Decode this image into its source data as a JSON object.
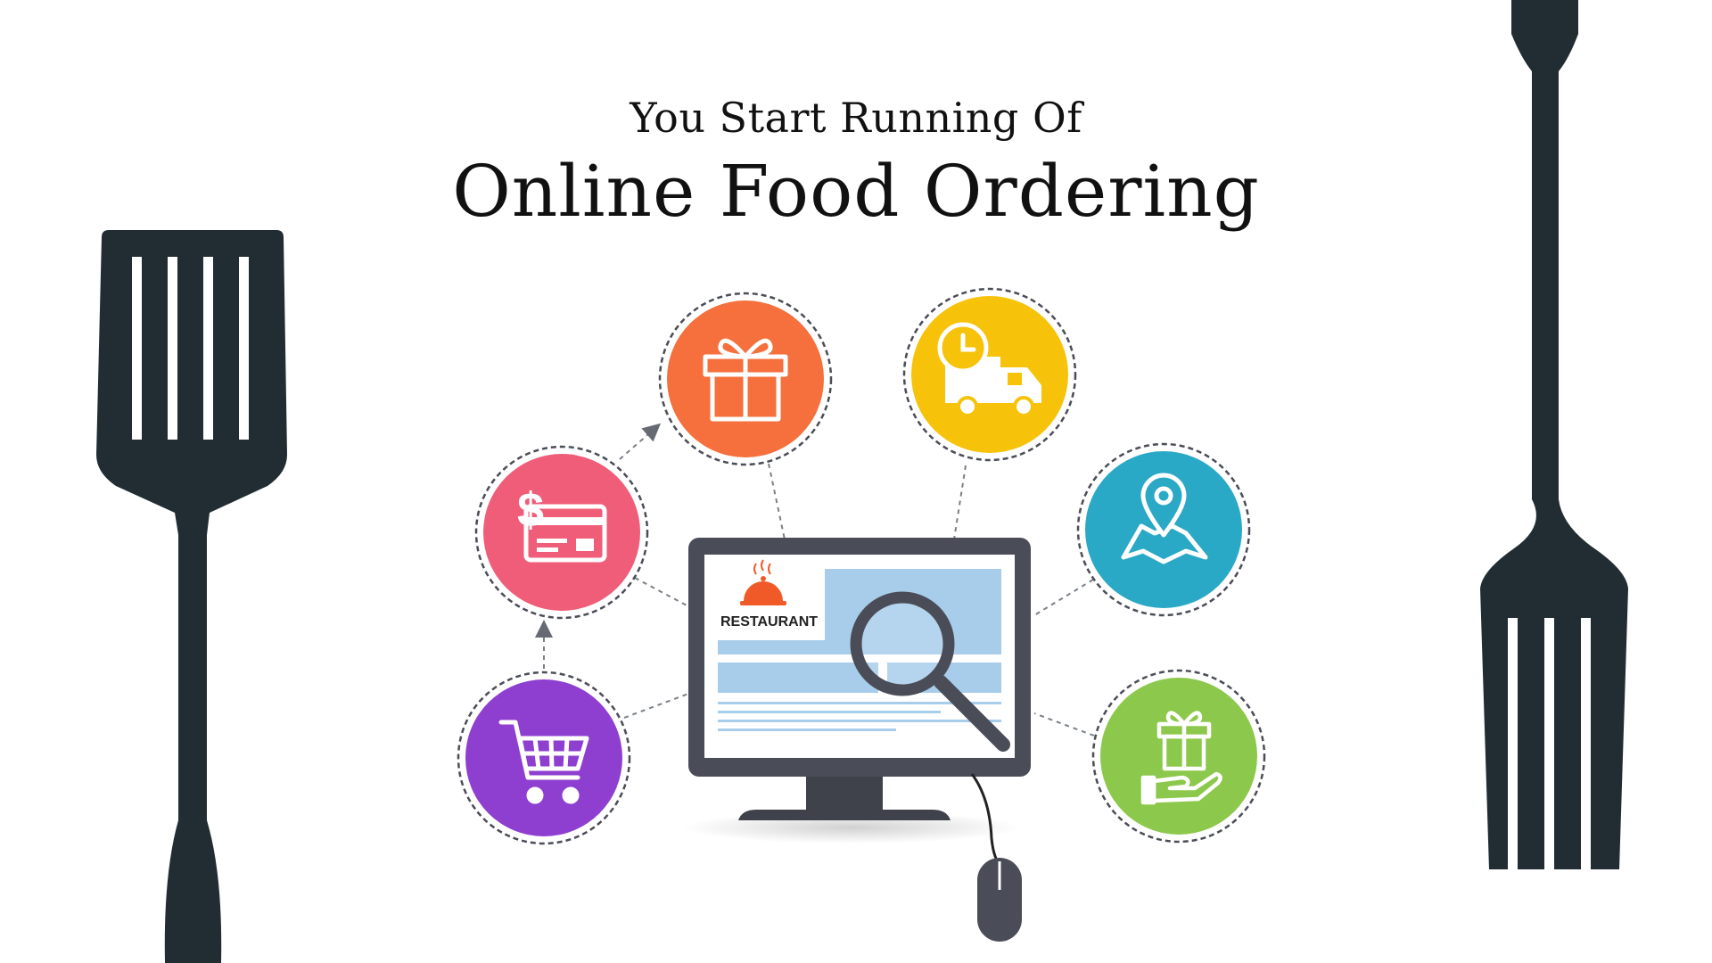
{
  "title": {
    "line1": "You Start Running Of",
    "line2": "Online Food Ordering"
  },
  "monitor": {
    "screen_label": "RESTAURANT"
  },
  "icons": {
    "left_utensil": "spatula-icon",
    "right_utensil": "fork-icon",
    "cart": "shopping-cart-icon",
    "payment": "dollar-card-icon",
    "gift": "gift-box-icon",
    "delivery": "clock-truck-icon",
    "location": "map-pin-icon",
    "gift_hand": "gift-in-hand-icon",
    "search": "magnifier-icon",
    "cloche": "cloche-icon",
    "mouse": "mouse-icon"
  },
  "colors": {
    "utensil": "#222d33",
    "cart": "#8e3fd0",
    "payment": "#ef5d78",
    "gift": "#f5703c",
    "delivery": "#f7c20a",
    "location": "#2aa9c6",
    "gift_hand": "#8cc84b",
    "monitor_frame": "#4a4d57",
    "screen_blue": "#a8cdea"
  }
}
